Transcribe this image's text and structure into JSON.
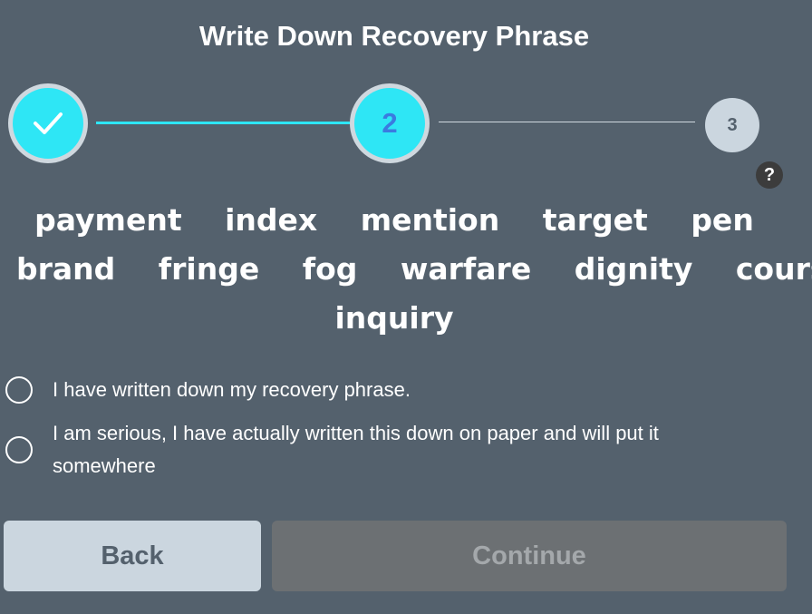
{
  "header": {
    "title": "Write Down Recovery Phrase"
  },
  "stepper": {
    "steps": [
      {
        "label": "",
        "state": "complete",
        "icon": "check-icon"
      },
      {
        "label": "2",
        "state": "active"
      },
      {
        "label": "3",
        "state": "pending"
      }
    ],
    "help_label": "?"
  },
  "phrase": {
    "rows": [
      [
        "payment",
        "index",
        "mention",
        "target",
        "pen"
      ],
      [
        "brand",
        "fringe",
        "fog",
        "warfare",
        "dignity",
        "course"
      ],
      [
        "inquiry"
      ]
    ]
  },
  "confirmations": [
    {
      "label": "I have written down my recovery phrase.",
      "checked": false
    },
    {
      "label": "I am serious, I have actually written this down on paper and will put it somewhere",
      "checked": false
    }
  ],
  "buttons": {
    "back_label": "Back",
    "continue_label": "Continue",
    "continue_disabled": true
  },
  "colors": {
    "background": "#54616d",
    "accent": "#2ee6f5",
    "step_number": "#3a7be0",
    "back_button": "#cbd6df",
    "continue_disabled": "#6c7073"
  }
}
